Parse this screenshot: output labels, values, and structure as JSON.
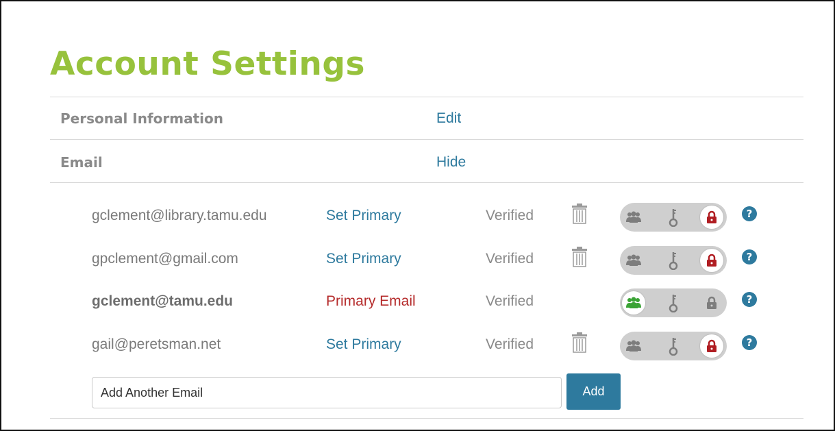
{
  "page": {
    "title": "Account Settings"
  },
  "sections": {
    "personal": {
      "label": "Personal Information",
      "action": "Edit"
    },
    "email": {
      "label": "Email",
      "action": "Hide"
    }
  },
  "emails": [
    {
      "address": "gclement@library.tamu.edu",
      "action": "Set Primary",
      "status": "Verified",
      "deletable": true,
      "visibility": "private"
    },
    {
      "address": "gpclement@gmail.com",
      "action": "Set Primary",
      "status": "Verified",
      "deletable": true,
      "visibility": "private"
    },
    {
      "address": "gclement@tamu.edu",
      "action": "Primary Email",
      "status": "Verified",
      "deletable": false,
      "visibility": "public"
    },
    {
      "address": "gail@peretsman.net",
      "action": "Set Primary",
      "status": "Verified",
      "deletable": true,
      "visibility": "private"
    }
  ],
  "help_glyph": "?",
  "add_email": {
    "placeholder": "Add Another Email",
    "button_label": "Add"
  },
  "icons": {
    "delete": "trash-icon",
    "public": "group-icon",
    "limited": "key-icon",
    "private": "lock-icon",
    "help": "question-icon"
  },
  "colors": {
    "title_green": "#97c23c",
    "link_blue": "#2e7a9e",
    "primary_red": "#b52b2b",
    "public_green": "#3aa335",
    "lock_red": "#b01d22",
    "icon_grey": "#7d7d7d",
    "toggle_bg": "#cfcfcf"
  }
}
